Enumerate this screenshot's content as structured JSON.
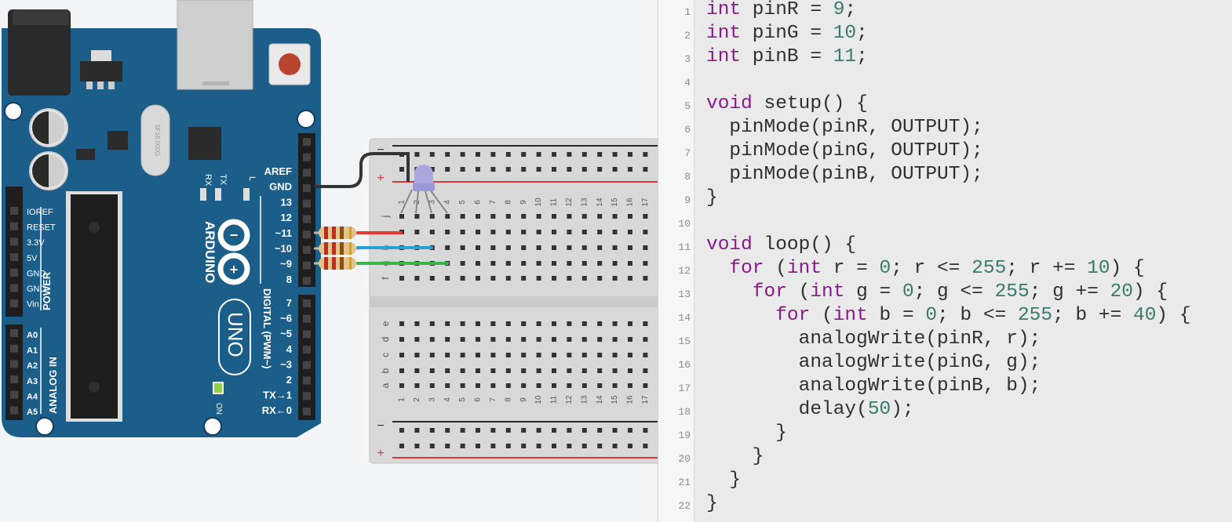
{
  "board": {
    "brand": "ARDUINO",
    "model": "UNO",
    "crystal_label": "5F16.000G",
    "on_label": "ON",
    "rx_led_label": "RX",
    "tx_led_label": "TX",
    "l_led_label": "L",
    "power_title": "POWER",
    "analog_title": "ANALOG IN",
    "digital_title": "DIGITAL (PWM~)",
    "power_pins": [
      "IOREF",
      "RESET",
      "3.3V",
      "5V",
      "GND",
      "GND",
      "Vin"
    ],
    "analog_pins": [
      "A0",
      "A1",
      "A2",
      "A3",
      "A4",
      "A5"
    ],
    "digital_pins_top": [
      "AREF",
      "GND",
      "13",
      "12",
      "~11",
      "~10",
      "~9",
      "8"
    ],
    "digital_pins_bottom": [
      "7",
      "~6",
      "~5",
      "4",
      "~3",
      "2",
      "TX→1",
      "RX←0"
    ]
  },
  "breadboard": {
    "minus_label": "−",
    "plus_label": "+",
    "row_labels_top": [
      "j",
      "i",
      "h",
      "g",
      "f"
    ],
    "row_labels_bottom": [
      "e",
      "d",
      "c",
      "b",
      "a"
    ],
    "column_numbers": [
      "1",
      "2",
      "3",
      "4",
      "5",
      "6",
      "7",
      "8",
      "9",
      "10",
      "11",
      "12",
      "13",
      "14",
      "15",
      "16",
      "17"
    ]
  },
  "colors": {
    "board_blue": "#1c5e8a",
    "wire_red": "#e53935",
    "wire_blue": "#2a9fd6",
    "wire_green": "#3ab54a",
    "wire_black": "#333333",
    "led": "#a9a7de",
    "keyword": "#8a1a8a",
    "number": "#3a7a6a"
  },
  "editor": {
    "line_numbers": [
      "1",
      "2",
      "3",
      "4",
      "5",
      "6",
      "7",
      "8",
      "9",
      "10",
      "11",
      "12",
      "13",
      "14",
      "15",
      "16",
      "17",
      "18",
      "19",
      "20",
      "21",
      "22"
    ],
    "lines": [
      [
        {
          "t": "int",
          "c": "kw"
        },
        {
          "t": " pinR = "
        },
        {
          "t": "9",
          "c": "num"
        },
        {
          "t": ";"
        }
      ],
      [
        {
          "t": "int",
          "c": "kw"
        },
        {
          "t": " pinG = "
        },
        {
          "t": "10",
          "c": "num"
        },
        {
          "t": ";"
        }
      ],
      [
        {
          "t": "int",
          "c": "kw"
        },
        {
          "t": " pinB = "
        },
        {
          "t": "11",
          "c": "num"
        },
        {
          "t": ";"
        }
      ],
      [],
      [
        {
          "t": "void",
          "c": "kw"
        },
        {
          "t": " setup() {"
        }
      ],
      [
        {
          "t": "  pinMode(pinR, OUTPUT);"
        }
      ],
      [
        {
          "t": "  pinMode(pinG, OUTPUT);"
        }
      ],
      [
        {
          "t": "  pinMode(pinB, OUTPUT);"
        }
      ],
      [
        {
          "t": "}"
        }
      ],
      [],
      [
        {
          "t": "void",
          "c": "kw"
        },
        {
          "t": " loop() {"
        }
      ],
      [
        {
          "t": "  "
        },
        {
          "t": "for",
          "c": "kw"
        },
        {
          "t": " ("
        },
        {
          "t": "int",
          "c": "kw"
        },
        {
          "t": " r = "
        },
        {
          "t": "0",
          "c": "num"
        },
        {
          "t": "; r <= "
        },
        {
          "t": "255",
          "c": "num"
        },
        {
          "t": "; r += "
        },
        {
          "t": "10",
          "c": "num"
        },
        {
          "t": ") {"
        }
      ],
      [
        {
          "t": "    "
        },
        {
          "t": "for",
          "c": "kw"
        },
        {
          "t": " ("
        },
        {
          "t": "int",
          "c": "kw"
        },
        {
          "t": " g = "
        },
        {
          "t": "0",
          "c": "num"
        },
        {
          "t": "; g <= "
        },
        {
          "t": "255",
          "c": "num"
        },
        {
          "t": "; g += "
        },
        {
          "t": "20",
          "c": "num"
        },
        {
          "t": ") {"
        }
      ],
      [
        {
          "t": "      "
        },
        {
          "t": "for",
          "c": "kw"
        },
        {
          "t": " ("
        },
        {
          "t": "int",
          "c": "kw"
        },
        {
          "t": " b = "
        },
        {
          "t": "0",
          "c": "num"
        },
        {
          "t": "; b <= "
        },
        {
          "t": "255",
          "c": "num"
        },
        {
          "t": "; b += "
        },
        {
          "t": "40",
          "c": "num"
        },
        {
          "t": ") {"
        }
      ],
      [
        {
          "t": "        analogWrite(pinR, r);"
        }
      ],
      [
        {
          "t": "        analogWrite(pinG, g);"
        }
      ],
      [
        {
          "t": "        analogWrite(pinB, b);"
        }
      ],
      [
        {
          "t": "        delay("
        },
        {
          "t": "50",
          "c": "num"
        },
        {
          "t": ");"
        }
      ],
      [
        {
          "t": "      }"
        }
      ],
      [
        {
          "t": "    }"
        }
      ],
      [
        {
          "t": "  }"
        }
      ],
      [
        {
          "t": "}"
        }
      ]
    ]
  }
}
